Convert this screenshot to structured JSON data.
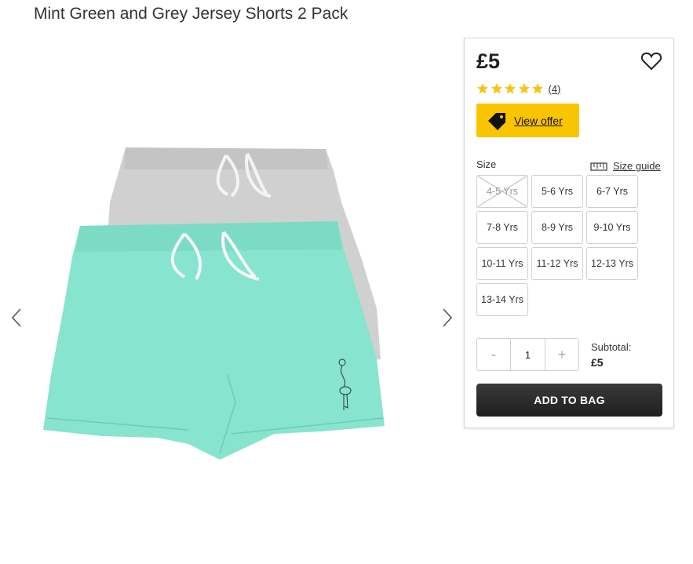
{
  "product": {
    "title": "Mint Green and Grey Jersey Shorts 2 Pack",
    "price": "£5",
    "rating": {
      "stars": 5,
      "review_count": "(4)"
    },
    "offer_label": "View offer",
    "size_label": "Size",
    "size_guide_label": "Size guide",
    "sizes": [
      {
        "label": "4-5 Yrs",
        "available": false
      },
      {
        "label": "5-6 Yrs",
        "available": true
      },
      {
        "label": "6-7 Yrs",
        "available": true
      },
      {
        "label": "7-8 Yrs",
        "available": true
      },
      {
        "label": "8-9 Yrs",
        "available": true
      },
      {
        "label": "9-10 Yrs",
        "available": true
      },
      {
        "label": "10-11 Yrs",
        "available": true
      },
      {
        "label": "11-12 Yrs",
        "available": true
      },
      {
        "label": "12-13 Yrs",
        "available": true
      },
      {
        "label": "13-14 Yrs",
        "available": true
      }
    ],
    "quantity": {
      "decrement": "-",
      "value": "1",
      "increment": "+"
    },
    "subtotal_label": "Subtotal:",
    "subtotal_value": "£5",
    "add_to_bag_label": "ADD TO BAG"
  },
  "icons": {
    "wishlist": "heart-outline-icon",
    "offer": "price-tag-icon",
    "size_guide": "ruler-icon",
    "prev": "chevron-left-icon",
    "next": "chevron-right-icon"
  },
  "colors": {
    "offer_yellow": "#f9c500",
    "star_yellow": "#f5c518",
    "button_dark": "#2b2b2b",
    "mint": "#7fe0cc",
    "grey_shorts": "#cfcfcf"
  }
}
